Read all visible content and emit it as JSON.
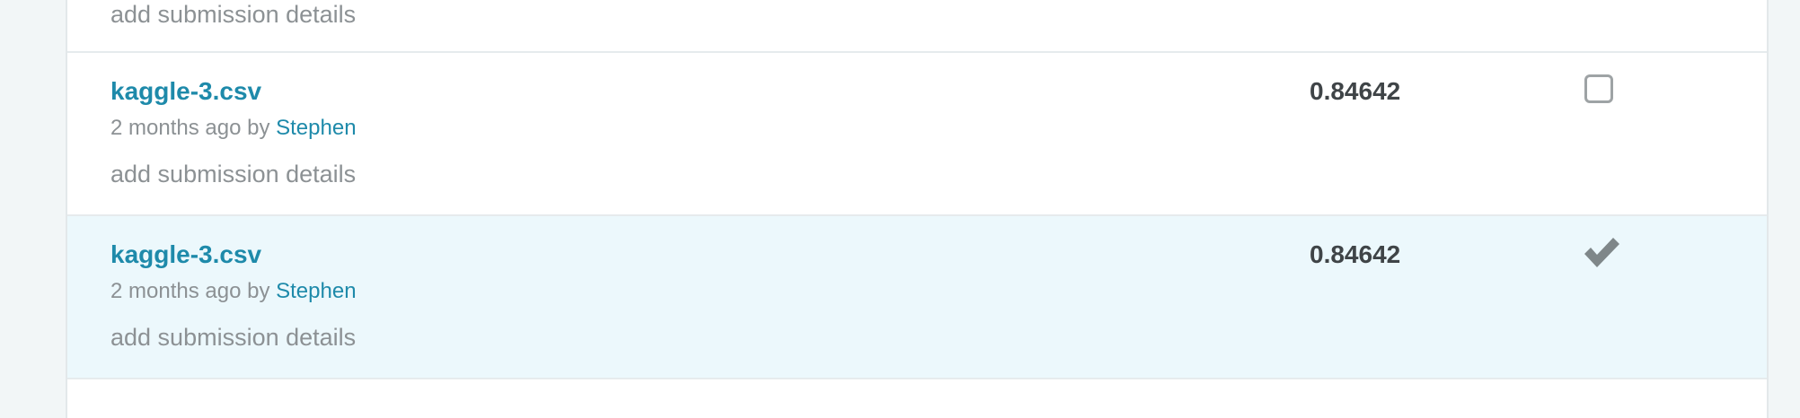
{
  "rows": [
    {
      "details_link": "add submission details"
    },
    {
      "filename": "kaggle-3.csv",
      "time_ago": "2 months ago by",
      "author": "Stephen",
      "details_link": "add submission details",
      "score": "0.84642",
      "selected": false
    },
    {
      "filename": "kaggle-3.csv",
      "time_ago": "2 months ago by",
      "author": "Stephen",
      "details_link": "add submission details",
      "score": "0.84642",
      "selected": true
    }
  ],
  "colors": {
    "link": "#1e8aaa",
    "selected_row_bg": "#ecf8fc",
    "muted_text": "#8c9194",
    "score_text": "#3f4447"
  },
  "icons": {
    "unselected": "checkbox-icon",
    "selected": "checkmark-icon"
  }
}
